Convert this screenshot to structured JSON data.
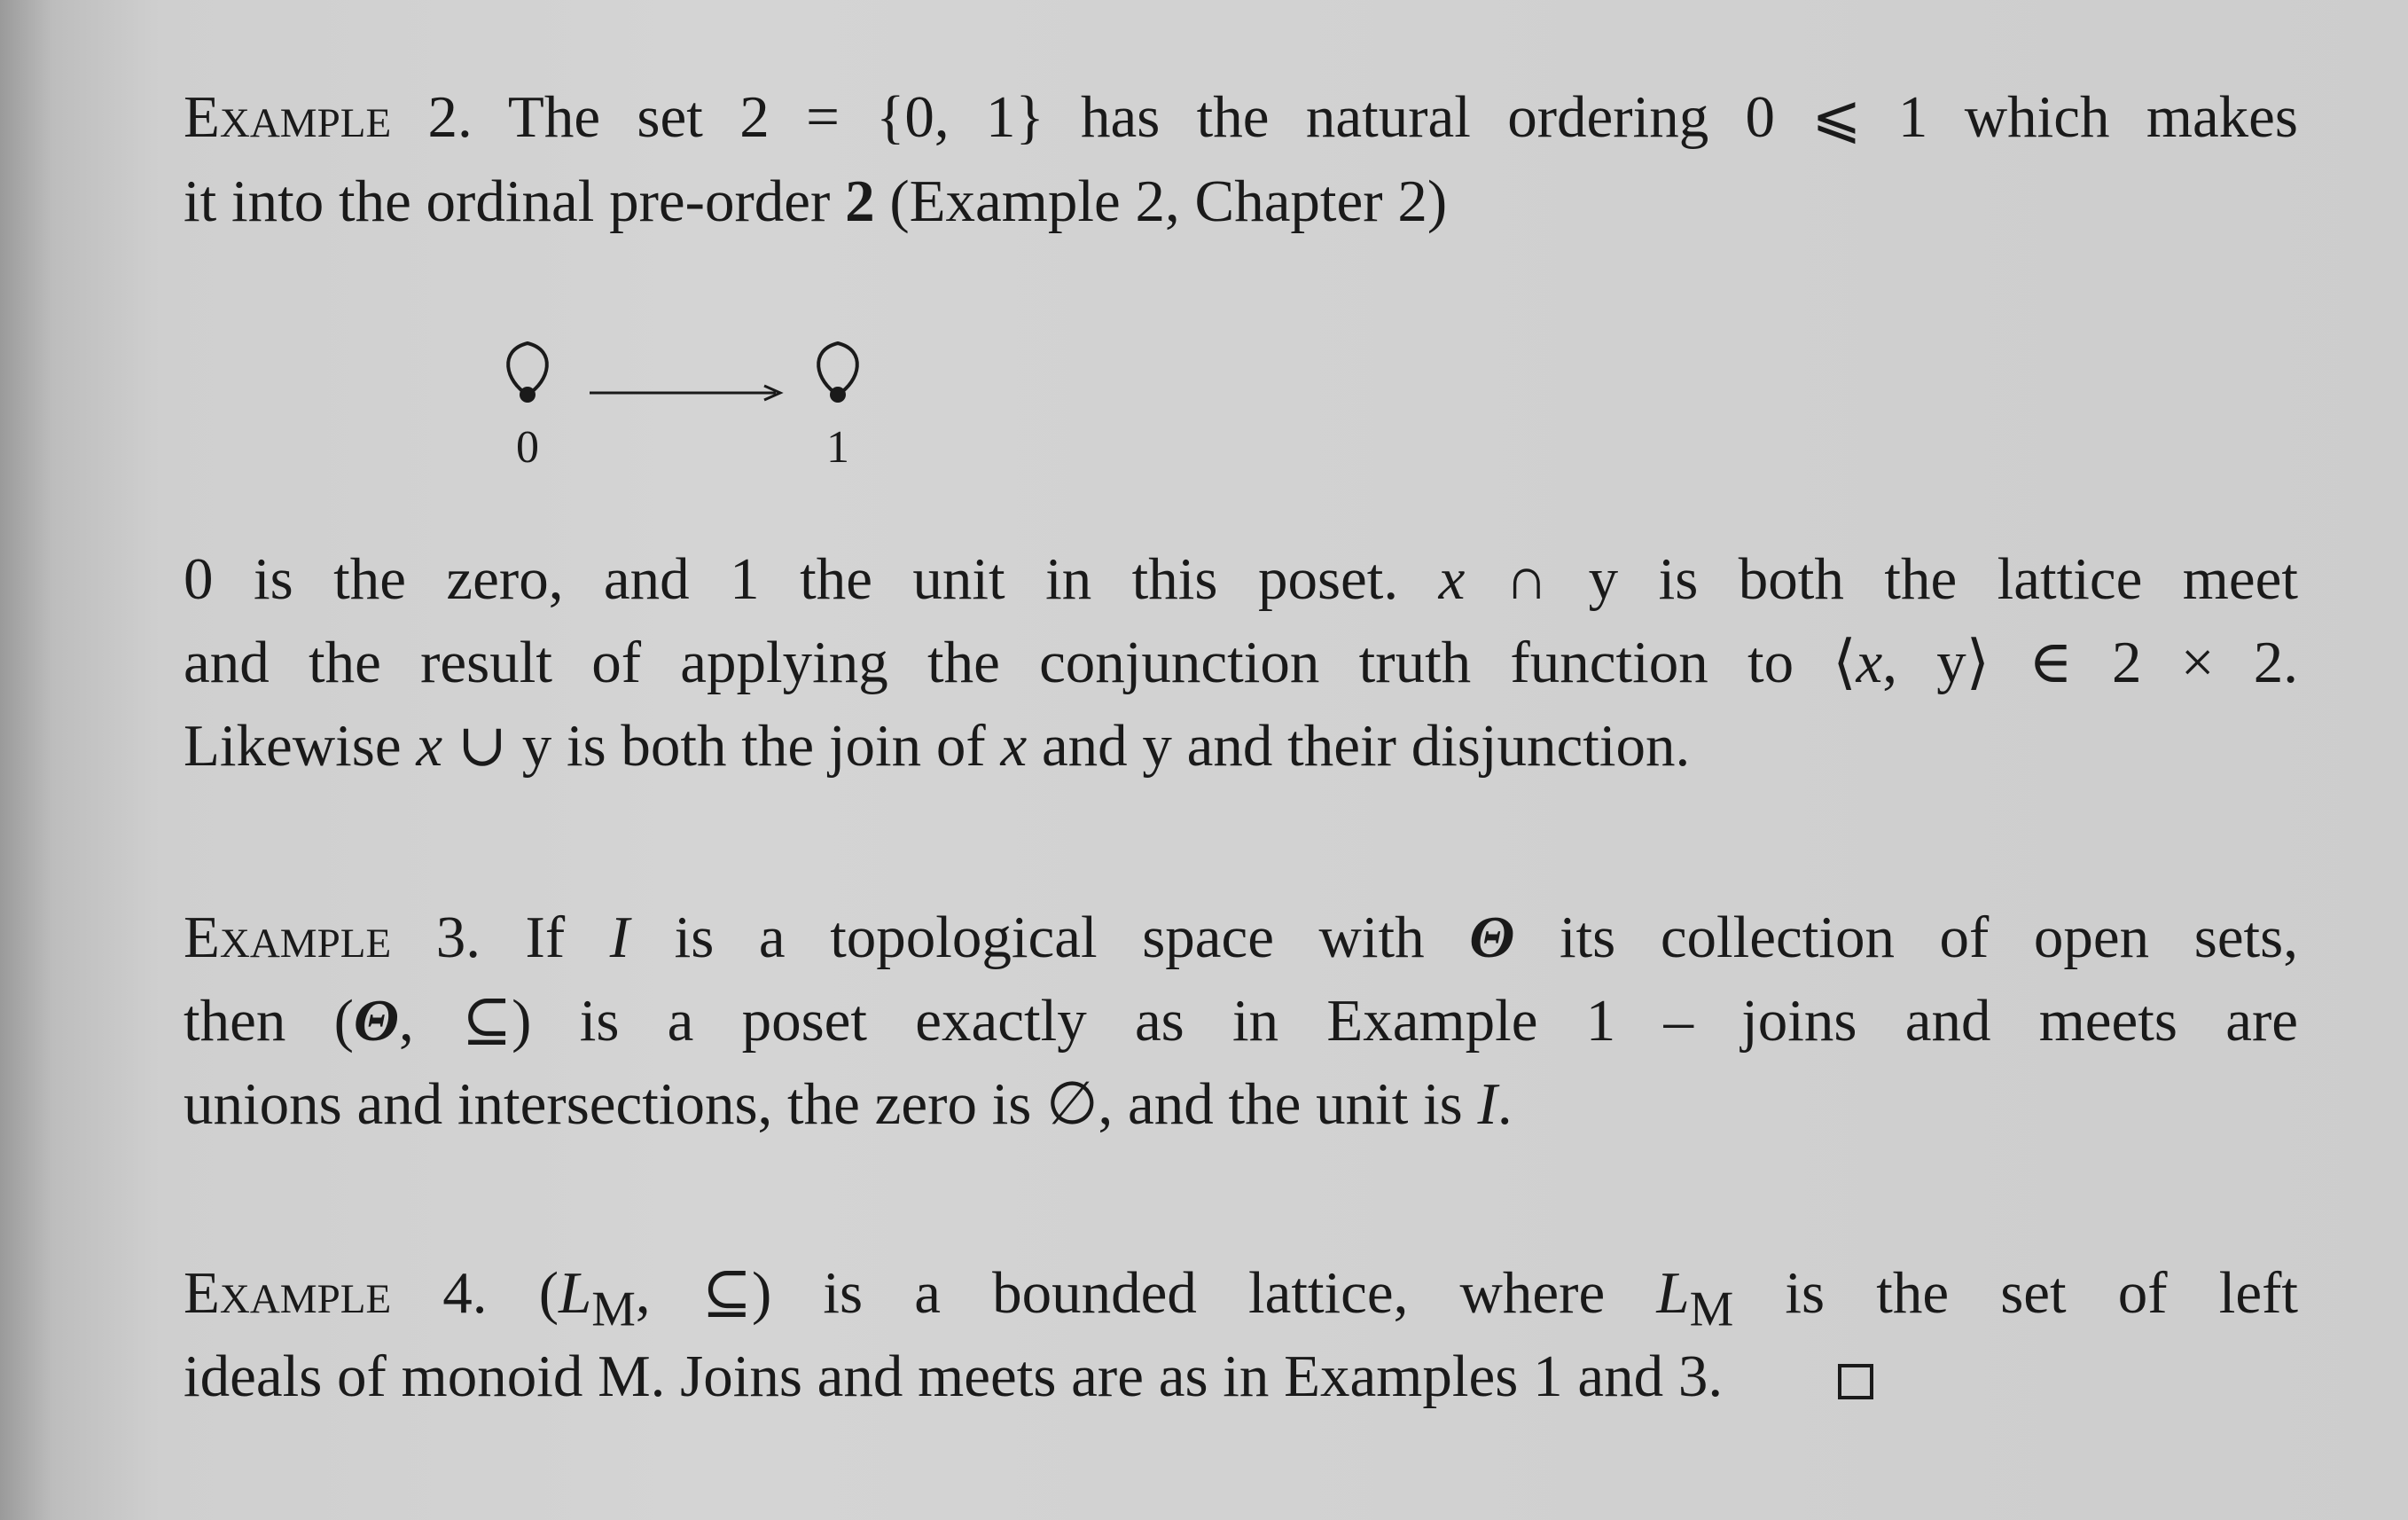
{
  "example2": {
    "line1": {
      "head": "Example",
      "rest": " 2. The set 2 = {0, 1} has the natural ordering 0 ⩽ 1 which makes"
    },
    "line2": {
      "a": "it into the ordinal pre-order ",
      "b": "2",
      "c": " (Example 2, Chapter 2)"
    },
    "diagram": {
      "node0": "0",
      "node1": "1"
    },
    "line3": {
      "a": "0 is the zero, and 1 the unit in this poset. ",
      "x": "x",
      "b": " ∩ y is both the lattice meet"
    },
    "line4": {
      "a": "and the result of applying the conjunction truth function to ⟨",
      "x": "x",
      "b": ", y⟩ ∈ 2 × 2."
    },
    "line5": {
      "a": "Likewise ",
      "x1": "x",
      "b": " ∪ y is both the join of ",
      "x2": "x",
      "c": " and y and their disjunction."
    }
  },
  "example3": {
    "line1": {
      "head": "Example",
      "a": " 3. If ",
      "I": "I",
      "b": " is a topological space with ",
      "theta": "Θ",
      "c": " its collection of open sets,"
    },
    "line2": {
      "a": "then (",
      "theta": "Θ",
      "b": ", ⊆) is a poset exactly as in Example 1 – joins and meets are"
    },
    "line3": {
      "a": "unions and intersections, the zero is ∅, and the unit is ",
      "I": "I",
      "b": "."
    }
  },
  "example4": {
    "line1": {
      "head": "Example",
      "a": " 4. (",
      "L1": "L",
      "M1": "M",
      "b": ", ⊆) is a bounded lattice, where ",
      "L2": "L",
      "M2": "M",
      "c": " is the set of left"
    },
    "line2": {
      "a": "ideals of monoid M. Joins and meets are as in Examples 1 and 3."
    }
  }
}
